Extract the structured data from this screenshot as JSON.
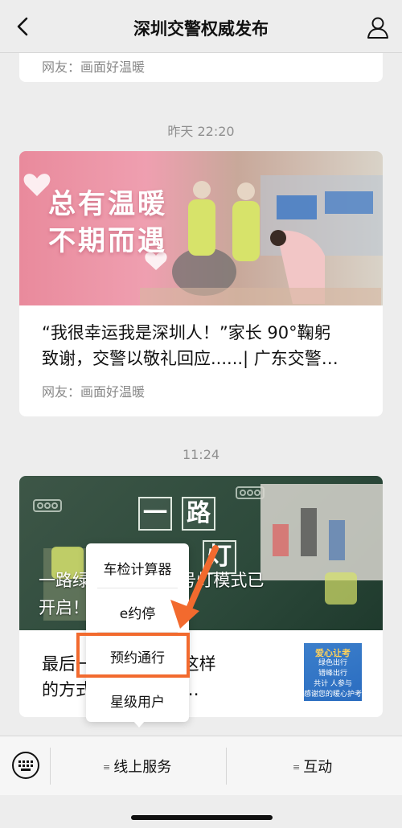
{
  "header": {
    "title": "深圳交警权威发布"
  },
  "feed": {
    "top_card": {
      "source": "网友：画面好温暖"
    },
    "groups": [
      {
        "timestamp": "昨天 22:20",
        "article": {
          "banner_text_line1": "总有温暖",
          "banner_text_line2": "不期而遇",
          "title_line1": "“我很幸运我是深圳人！”家长 90°鞠躬",
          "title_line2": "致谢，交警以敬礼回应......| 广东交警…",
          "source": "网友：画面好温暖"
        }
      },
      {
        "timestamp": "11:24",
        "article": {
          "banner_tiles": [
            "一",
            "路",
            "灯"
          ],
          "banner_headline_line1": "一路绿灯 “专属”信号灯模式已",
          "banner_headline_line2": "开启！ 护航高考",
          "title_line1": "最后一天 为车主以这样",
          "title_line2": "的方式 广东交警护…",
          "thumb_line1": "爱心让考",
          "thumb_line2": "绿色出行",
          "thumb_line3": "错峰出行",
          "thumb_line4": "共计 人参与",
          "thumb_line5": "感谢您的暖心护考"
        }
      }
    ]
  },
  "popup_menu": {
    "items": [
      "车检计算器",
      "e约停",
      "预约通行",
      "星级用户"
    ],
    "highlighted_index": 2
  },
  "bottom_menu": {
    "keyboard_icon": "keyboard-icon",
    "tabs": [
      "线上服务",
      "互动"
    ]
  },
  "colors": {
    "highlight": "#f26a2e",
    "background": "#ededed"
  }
}
